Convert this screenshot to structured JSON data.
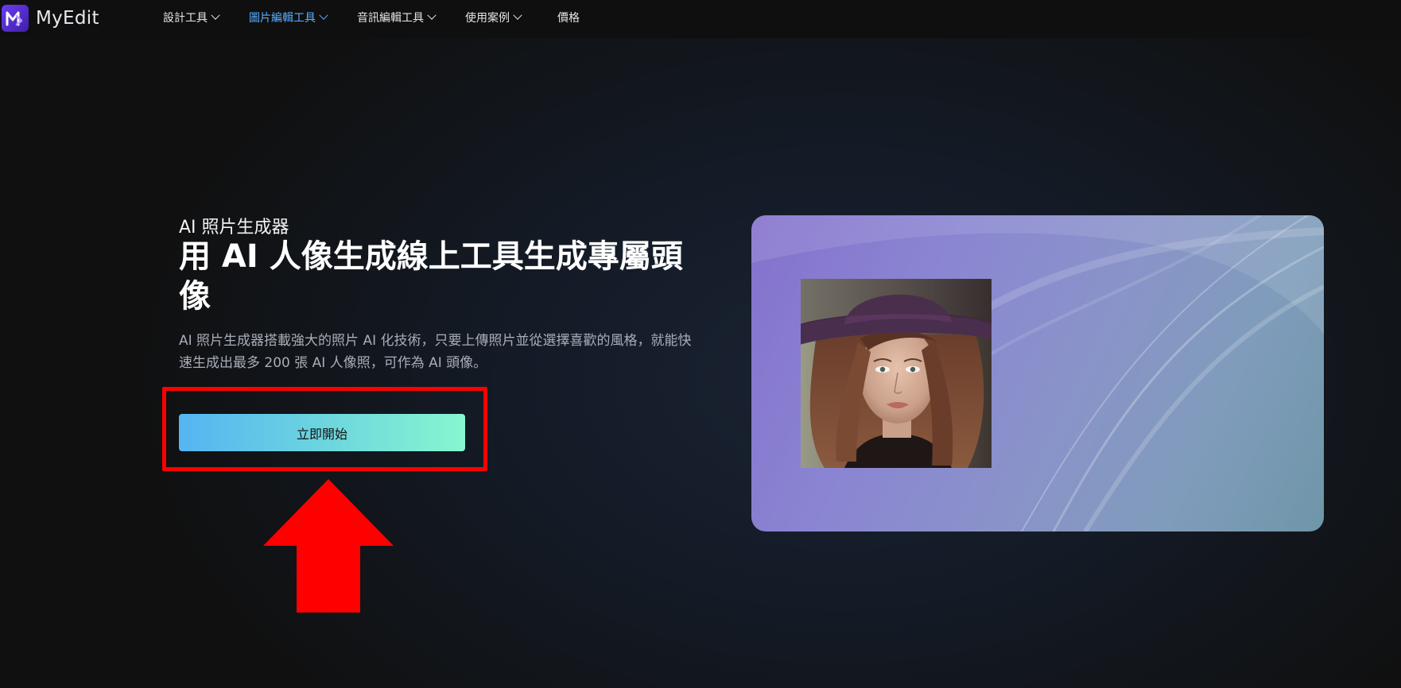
{
  "app": {
    "brand": "MyEdit",
    "logo_icon": "myedit-logo-icon"
  },
  "nav": {
    "items": [
      {
        "label": "設計工具",
        "has_dropdown": true,
        "active": false
      },
      {
        "label": "圖片編輯工具",
        "has_dropdown": true,
        "active": true
      },
      {
        "label": "音訊編輯工具",
        "has_dropdown": true,
        "active": false
      },
      {
        "label": "使用案例",
        "has_dropdown": true,
        "active": false
      },
      {
        "label": "價格",
        "has_dropdown": false,
        "active": false
      }
    ]
  },
  "hero": {
    "subtitle": "AI 照片生成器",
    "title": "用 AI 人像生成線上工具生成專屬頭像",
    "description": "AI 照片生成器搭載強大的照片 AI 化技術，只要上傳照片並從選擇喜歡的風格，就能快速生成出最多 200 張 AI 人像照，可作為 AI 頭像。",
    "cta_label": "立即開始"
  },
  "preview": {
    "image": "ai-portrait-sample-image"
  },
  "annotation": {
    "highlight_color": "#ff0000",
    "arrow_icon": "red-up-arrow-icon"
  },
  "colors": {
    "active_nav": "#5aaeff",
    "cta_gradient_start": "#55b4f2",
    "cta_gradient_end": "#86f7cf",
    "card_gradient_start": "#8571cd",
    "card_gradient_end": "#6f96a8"
  }
}
